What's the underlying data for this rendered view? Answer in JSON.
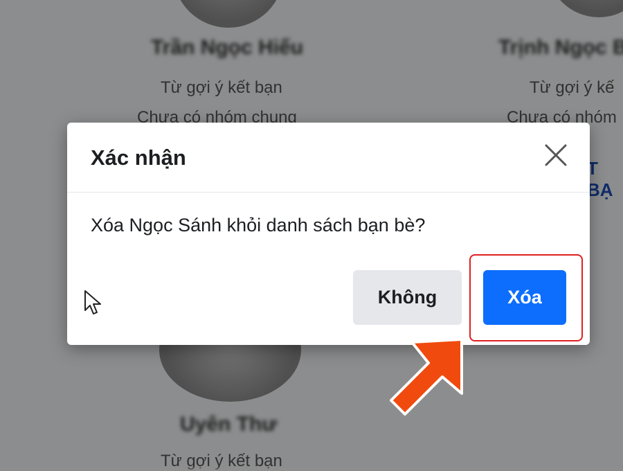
{
  "background_cards": [
    {
      "name": "Trần Ngọc Hiếu",
      "line1": "Từ gợi ý kết bạn",
      "line2": "Chưa có nhóm chung"
    },
    {
      "name": "Trịnh Ngọc B",
      "line1": "Từ gợi ý kế",
      "line2": "Chưa có nhóm",
      "button": "T BẠ"
    },
    {
      "name": "Uyên Thư",
      "line1": "Từ gợi ý kết bạn"
    }
  ],
  "dialog": {
    "title": "Xác nhận",
    "message": "Xóa Ngọc Sánh khỏi danh sách bạn bè?",
    "cancel_label": "Không",
    "confirm_label": "Xóa"
  },
  "colors": {
    "confirm_button": "#0d6efd",
    "cancel_button": "#e6e7eb",
    "highlight": "#e02020",
    "pointer_arrow": "#f04a0e"
  },
  "icons": [
    "close-icon",
    "mouse-cursor-icon",
    "pointer-arrow-icon"
  ]
}
